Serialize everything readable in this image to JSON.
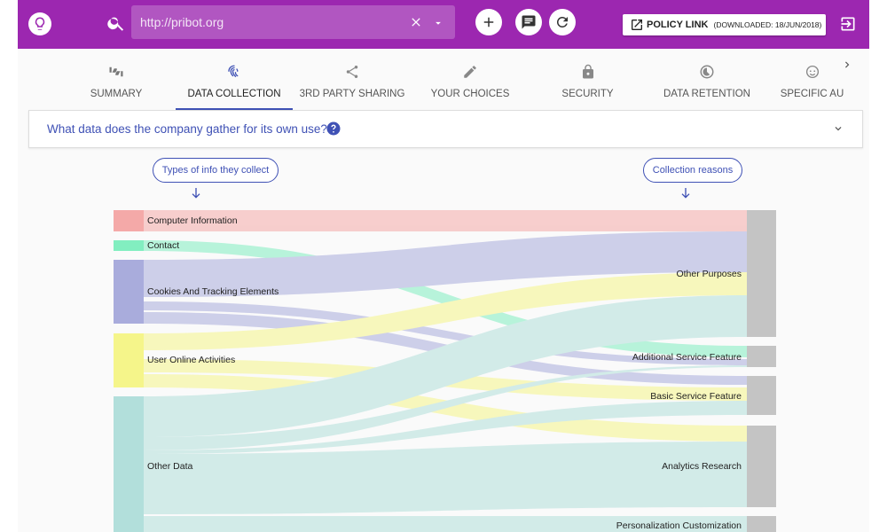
{
  "header": {
    "url": "http://pribot.org",
    "policy_label": "POLICY LINK",
    "policy_downloaded": "(DOWNLOADED: 18/JUN/2018)"
  },
  "tabs": [
    {
      "label": "SUMMARY",
      "icon": "thumbs-icon"
    },
    {
      "label": "DATA COLLECTION",
      "icon": "fingerprint-icon",
      "active": true
    },
    {
      "label": "3RD PARTY SHARING",
      "icon": "share-icon"
    },
    {
      "label": "YOUR CHOICES",
      "icon": "pencil-icon"
    },
    {
      "label": "SECURITY",
      "icon": "lock-icon"
    },
    {
      "label": "DATA RETENTION",
      "icon": "timelapse-icon"
    },
    {
      "label": "SPECIFIC AU",
      "icon": "child-face-icon"
    }
  ],
  "question": {
    "text": "What data does the company gather for its own use?"
  },
  "sankey": {
    "left_header": "Types of info they collect",
    "right_header": "Collection reasons",
    "sources": [
      {
        "name": "Computer Information",
        "color": "#f4a9a8"
      },
      {
        "name": "Contact",
        "color": "#82eec0"
      },
      {
        "name": "Cookies And Tracking Elements",
        "color": "#a9acdc"
      },
      {
        "name": "User Online Activities",
        "color": "#f5f58a"
      },
      {
        "name": "Other Data",
        "color": "#b2dfdb"
      }
    ],
    "targets": [
      {
        "name": "Other Purposes"
      },
      {
        "name": "Additional Service Feature"
      },
      {
        "name": "Basic Service Feature"
      },
      {
        "name": "Analytics Research"
      },
      {
        "name": "Personalization Customization"
      }
    ]
  },
  "colors": {
    "header_bg": "#9c27b0",
    "accent": "#3f51b5",
    "target_node": "#c4c4c4"
  }
}
